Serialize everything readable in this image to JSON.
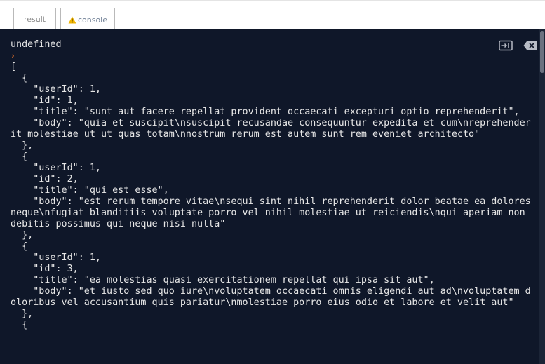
{
  "tabs": [
    {
      "label": "result",
      "active": false
    },
    {
      "label": "console",
      "active": true,
      "icon": "warning-icon"
    }
  ],
  "toolbar": {
    "dock_icon": "dock-panel-icon",
    "clear_icon": "clear-console-icon"
  },
  "console": {
    "first_line": "undefined",
    "output": "[\n  {\n    \"userId\": 1,\n    \"id\": 1,\n    \"title\": \"sunt aut facere repellat provident occaecati excepturi optio reprehenderit\",\n    \"body\": \"quia et suscipit\\nsuscipit recusandae consequuntur expedita et cum\\nreprehenderit molestiae ut ut quas totam\\nnostrum rerum est autem sunt rem eveniet architecto\"\n  },\n  {\n    \"userId\": 1,\n    \"id\": 2,\n    \"title\": \"qui est esse\",\n    \"body\": \"est rerum tempore vitae\\nsequi sint nihil reprehenderit dolor beatae ea dolores neque\\nfugiat blanditiis voluptate porro vel nihil molestiae ut reiciendis\\nqui aperiam non debitis possimus qui neque nisi nulla\"\n  },\n  {\n    \"userId\": 1,\n    \"id\": 3,\n    \"title\": \"ea molestias quasi exercitationem repellat qui ipsa sit aut\",\n    \"body\": \"et iusto sed quo iure\\nvoluptatem occaecati omnis eligendi aut ad\\nvoluptatem doloribus vel accusantium quis pariatur\\nmolestiae porro eius odio et labore et velit aut\"\n  },\n  {"
  },
  "colors": {
    "panel_bg": "#0f1729",
    "text": "#e6e6e6",
    "chevron": "#e8742b",
    "warning": "#f0b400"
  }
}
